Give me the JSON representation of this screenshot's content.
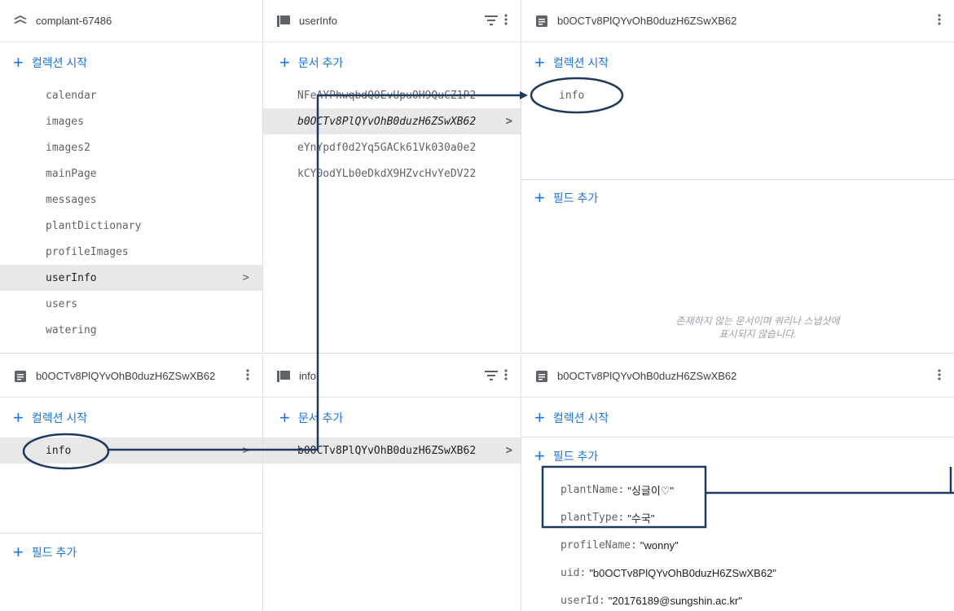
{
  "top": {
    "col1": {
      "title": "complant-67486",
      "add_collection": "컬렉션 시작",
      "collections": [
        "calendar",
        "images",
        "images2",
        "mainPage",
        "messages",
        "plantDictionary",
        "profileImages",
        "userInfo",
        "users",
        "watering"
      ],
      "selected_chevron": ">"
    },
    "col2": {
      "title": "userInfo",
      "add_document": "문서 추가",
      "documents": [
        "NFeAYPhwqbdQ0EvUpuOH9QuCZ1P2",
        "b0OCTv8PlQYvOhB0duzH6ZSwXB62",
        "eYnYpdf0d2Yq5GACk61Vk030a0e2",
        "kCY0odYLb0eDkdX9HZvcHvYeDV22"
      ],
      "selected_chevron": ">"
    },
    "col3": {
      "title": "b0OCTv8PlQYvOhB0duzH6ZSwXB62",
      "add_collection": "컬렉션 시작",
      "subcollections": [
        "info"
      ],
      "add_field": "필드 추가",
      "note_line1": "존재하지 않는 문서이며 쿼리나 스냅샷에",
      "note_line2": "표시되지 않습니다."
    }
  },
  "bottom": {
    "col1": {
      "title": "b0OCTv8PlQYvOhB0duzH6ZSwXB62",
      "add_collection": "컬렉션 시작",
      "subcollections": [
        "info"
      ],
      "selected_chevron": ">",
      "add_field": "필드 추가"
    },
    "col2": {
      "title": "info",
      "add_document": "문서 추가",
      "documents": [
        "b0OCTv8PlQYvOhB0duzH6ZSwXB62"
      ],
      "selected_chevron": ">"
    },
    "col3": {
      "title": "b0OCTv8PlQYvOhB0duzH6ZSwXB62",
      "add_collection": "컬렉션 시작",
      "add_field": "필드 추가",
      "fields": [
        {
          "key": "plantName:",
          "value": "\"싱글이♡\""
        },
        {
          "key": "plantType:",
          "value": "\"수국\""
        },
        {
          "key": "profileName:",
          "value": "\"wonny\""
        },
        {
          "key": "uid:",
          "value": "\"b0OCTv8PlQYvOhB0duzH6ZSwXB62\""
        },
        {
          "key": "userId:",
          "value": "\"20176189@sungshin.ac.kr\""
        }
      ]
    }
  },
  "icons": {
    "project": "firestore-icon",
    "collection": "collection-icon",
    "document": "document-icon",
    "filter": "filter-icon",
    "menu": "more-vert-icon"
  },
  "colors": {
    "accent": "#1a73e8",
    "annotation": "#1f3a5f"
  }
}
